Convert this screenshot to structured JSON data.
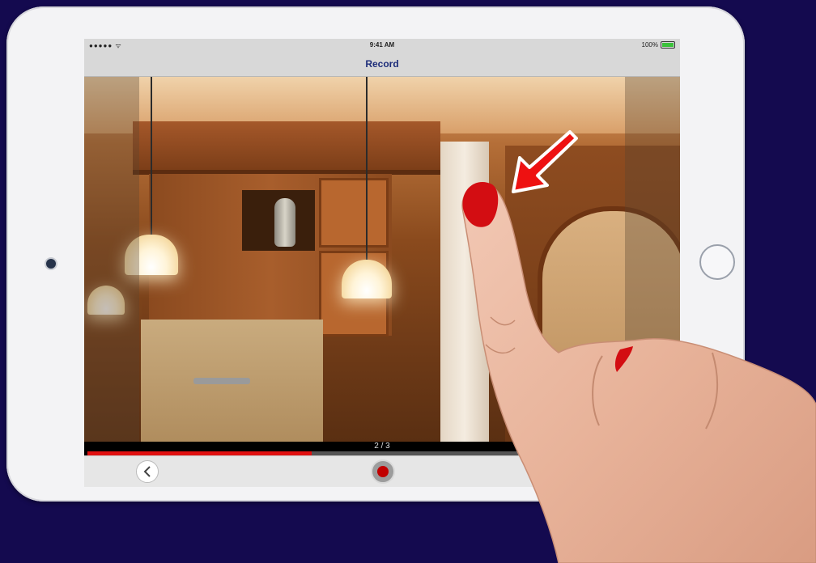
{
  "status_bar": {
    "signal": "●●●●● ᯤ",
    "time": "9:41 AM",
    "battery": "100%"
  },
  "nav": {
    "title": "Record"
  },
  "viewer": {
    "page_indicator": "2 / 3",
    "progress": 0.38
  },
  "toolbar": {
    "back_icon": "chevron-left-icon",
    "record_icon": "record-icon"
  },
  "colors": {
    "background": "#140a4f",
    "nav_title": "#1d2d7a",
    "progress": "#e01010",
    "record": "#c10000",
    "arrow": "#ee1111"
  }
}
